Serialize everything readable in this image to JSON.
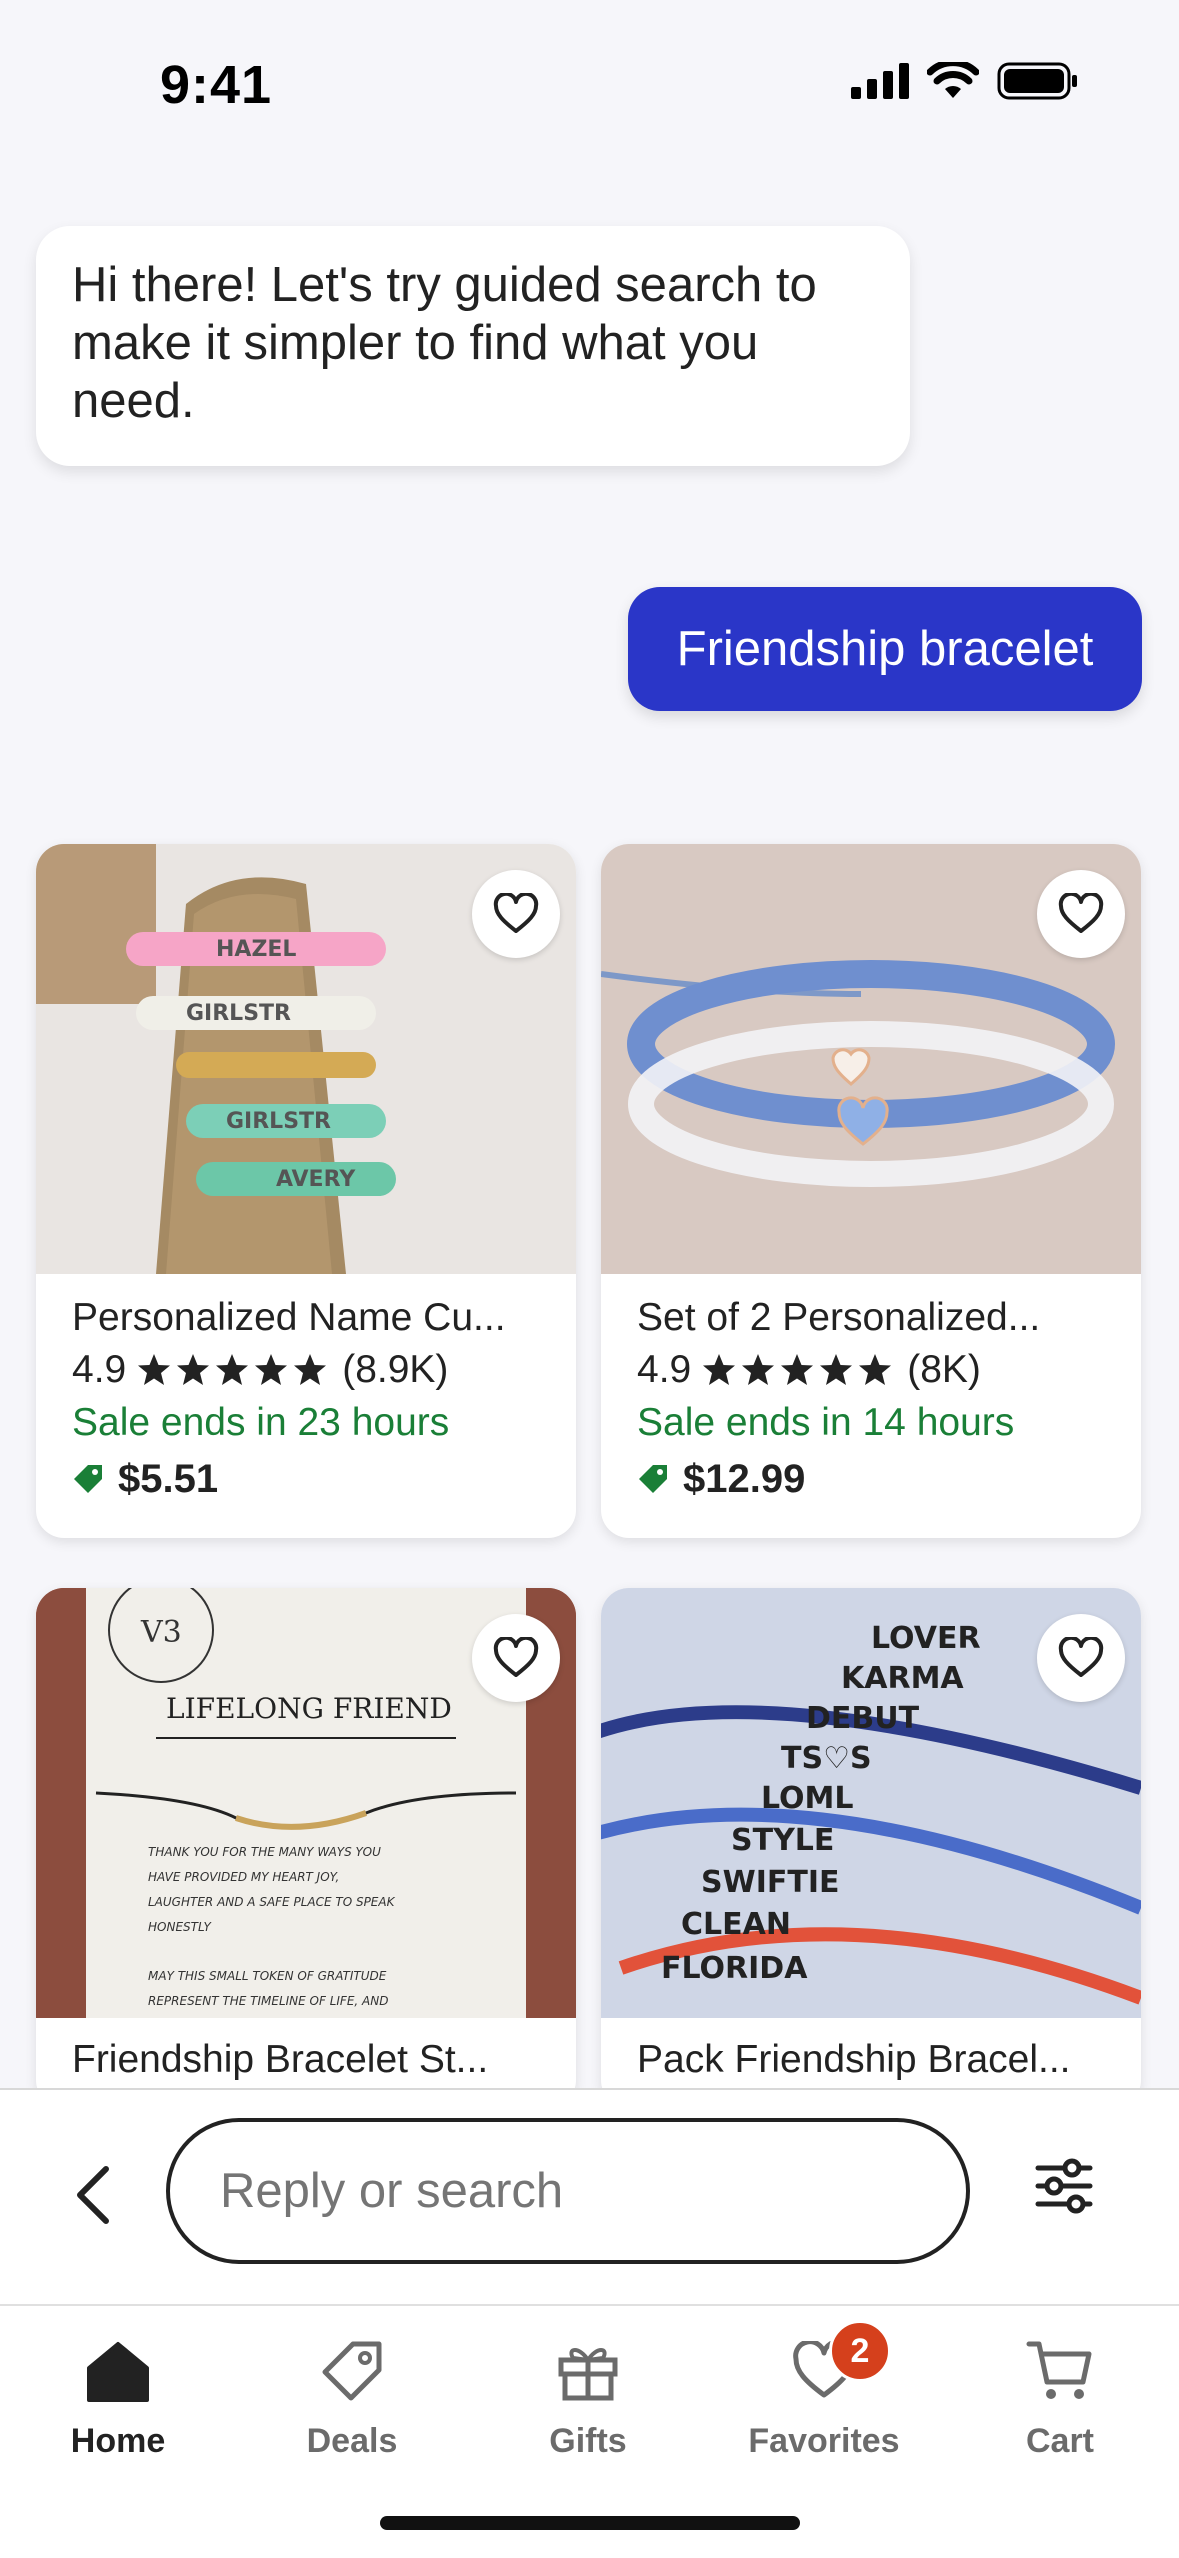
{
  "status_bar": {
    "time": "9:41"
  },
  "chat": {
    "bot_message": "Hi there! Let's try guided search to make it simpler to find what you need.",
    "user_message": "Friendship bracelet"
  },
  "products": [
    {
      "title": "Personalized Name Cu...",
      "rating": "4.9",
      "reviews": "(8.9K)",
      "sale": "Sale ends in 23 hours",
      "price": "$5.51",
      "image_text": [
        "HAZEL",
        "GIRLSTR",
        "GIRLSTR",
        "AVERY"
      ]
    },
    {
      "title": "Set of 2 Personalized...",
      "rating": "4.9",
      "reviews": "(8K)",
      "sale": "Sale ends in 14 hours",
      "price": "$12.99"
    },
    {
      "title": "Friendship Bracelet St...",
      "image_text": [
        "V3",
        "LIFELONG FRIEND",
        "THANK YOU FOR THE MANY WAYS YOU",
        "HAVE PROVIDED MY HEART JOY,",
        "LAUGHTER AND A SAFE PLACE TO SPEAK",
        "HONESTLY",
        "MAY THIS SMALL TOKEN OF GRATITUDE",
        "REPRESENT THE TIMELINE OF LIFE, AND"
      ]
    },
    {
      "title": "Pack Friendship Bracel...",
      "image_text": [
        "LOVER",
        "KARMA",
        "DEBUT",
        "TS♡S",
        "LOML",
        "STYLE",
        "SWIFTIE",
        "CLEAN",
        "FLORIDA"
      ]
    }
  ],
  "search_bar": {
    "placeholder": "Reply or search"
  },
  "tabs": [
    {
      "label": "Home",
      "icon": "home-icon",
      "active": true
    },
    {
      "label": "Deals",
      "icon": "tag-icon"
    },
    {
      "label": "Gifts",
      "icon": "gift-icon"
    },
    {
      "label": "Favorites",
      "icon": "heart-icon",
      "badge": "2"
    },
    {
      "label": "Cart",
      "icon": "cart-icon"
    }
  ],
  "colors": {
    "accent": "#2a36c8",
    "sale_green": "#1a7f37",
    "badge_orange": "#d5401c"
  }
}
